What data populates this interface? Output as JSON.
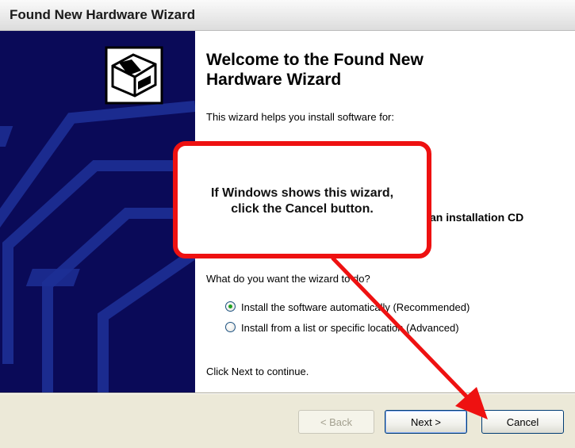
{
  "window": {
    "title": "Found New Hardware Wizard"
  },
  "content": {
    "heading_line1": "Welcome to the Found New",
    "heading_line2": "Hardware Wizard",
    "intro": "This wizard helps you install software for:",
    "partial_text": "an installation CD",
    "question": "What do you want the wizard to do?",
    "options": [
      {
        "label": "Install the software automatically (Recommended)",
        "selected": true
      },
      {
        "label": "Install from a list or specific location (Advanced)",
        "selected": false
      }
    ],
    "continue_hint": "Click Next to continue."
  },
  "buttons": {
    "back": "< Back",
    "next": "Next >",
    "cancel": "Cancel"
  },
  "callout": {
    "line1": "If Windows shows this wizard,",
    "line2": "click the Cancel button."
  },
  "icons": {
    "hardware": "hardware-box-icon"
  },
  "colors": {
    "callout_border": "#ee1111",
    "side_panel": "#0a0a58",
    "radio_selected": "#21a121"
  }
}
